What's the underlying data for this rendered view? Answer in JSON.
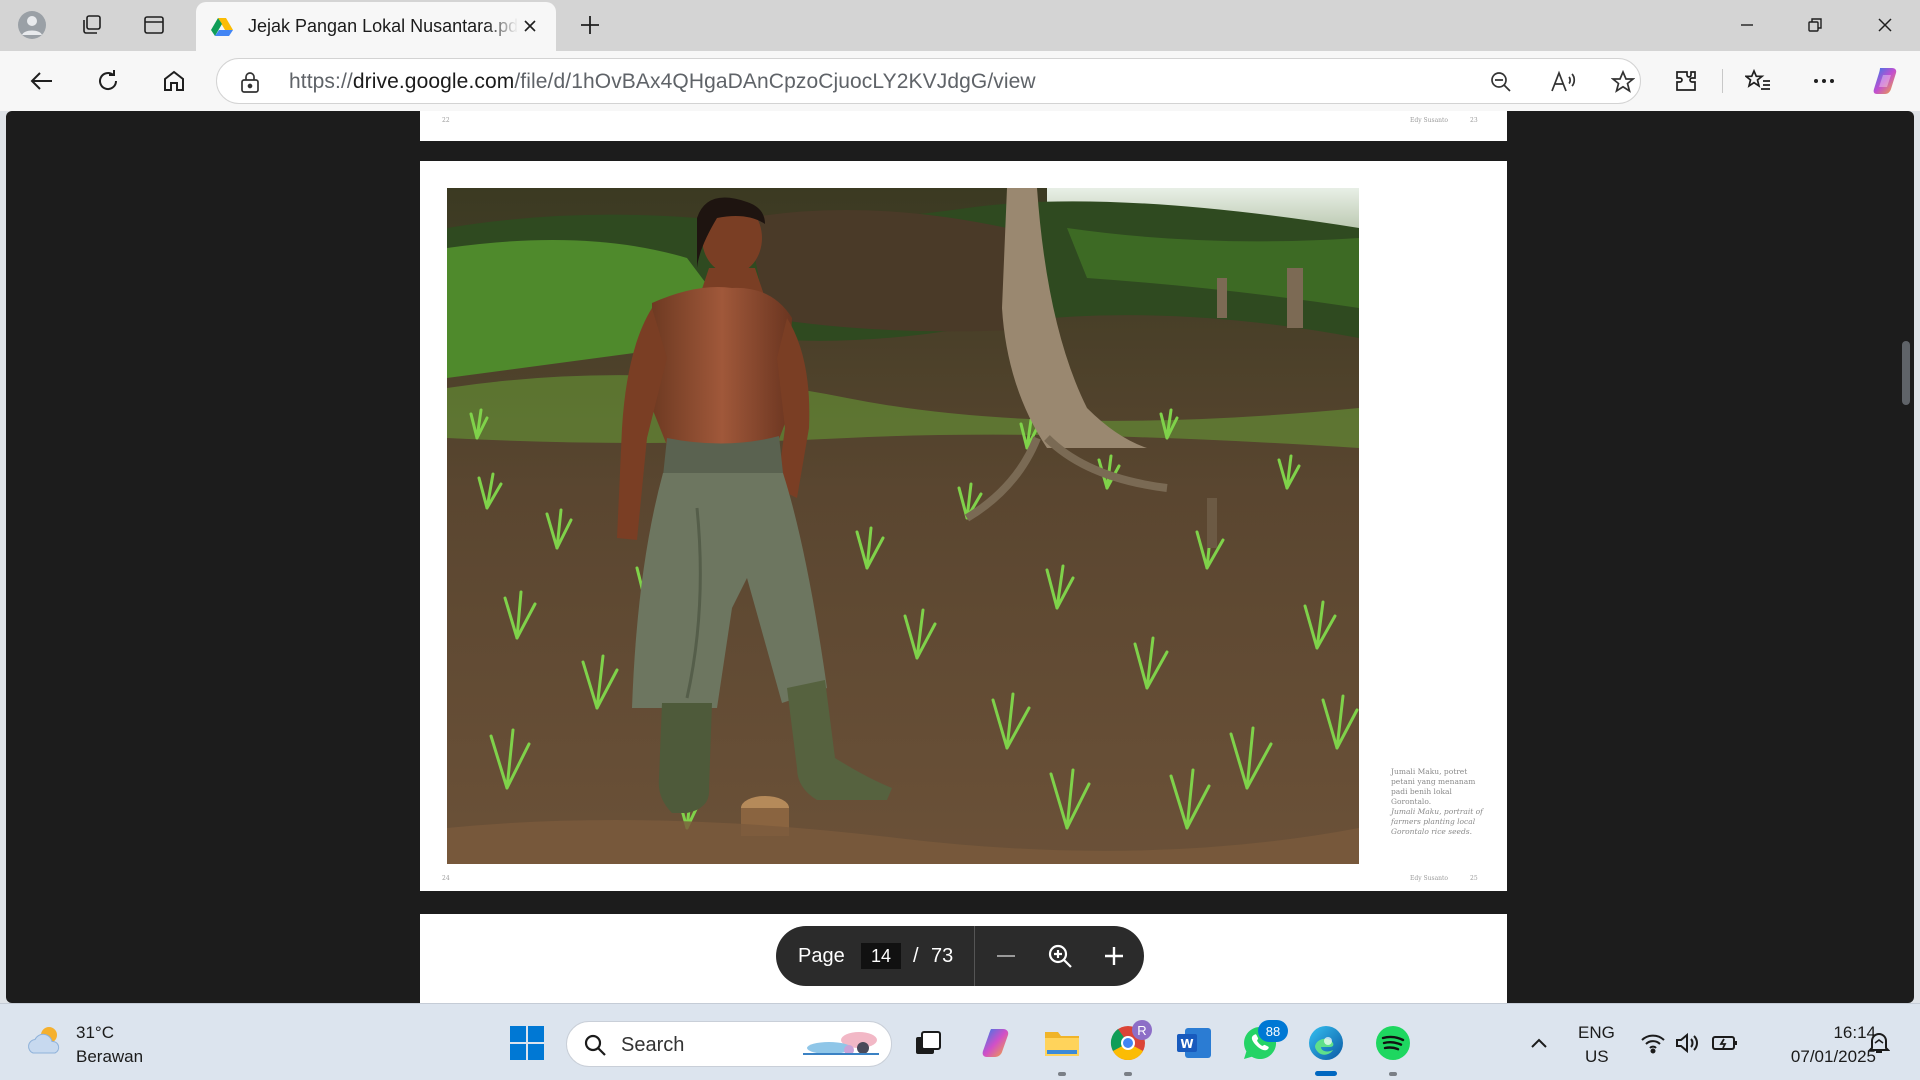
{
  "tab": {
    "title": "Jejak Pangan Lokal Nusantara.pdf"
  },
  "address_bar": {
    "url_prefix": "https://",
    "url_domain": "drive.google.com",
    "url_path": "/file/d/1hOvBAx4QHgaDAnCpzoCjuocLY2KVJdgG/view"
  },
  "document": {
    "prev_page_left_number": "22",
    "prev_page_author": "Edy Susanto",
    "prev_page_right_number": "23",
    "page_left_number": "24",
    "page_author": "Edy Susanto",
    "page_right_number": "25",
    "caption_id": "Jumali Maku, potret petani yang menanam padi benih lokal Gorontalo.",
    "caption_en": "Jumali Maku, portrait of farmers planting local Gorontalo rice seeds."
  },
  "page_toolbar": {
    "label": "Page",
    "current_page": "14",
    "separator": "/",
    "total_pages": "73"
  },
  "taskbar": {
    "weather_temp": "31°C",
    "weather_desc": "Berawan",
    "search_label": "Search",
    "whatsapp_badge": "88",
    "chrome_badge": "R",
    "lang_primary": "ENG",
    "lang_region": "US",
    "time": "16:14",
    "date": "07/01/2025"
  },
  "colors": {
    "accent": "#0067c0",
    "viewer_bg": "#1c1c1c",
    "toolbar_bg": "#2b2b2b",
    "whatsapp_badge": "#0078d4"
  }
}
